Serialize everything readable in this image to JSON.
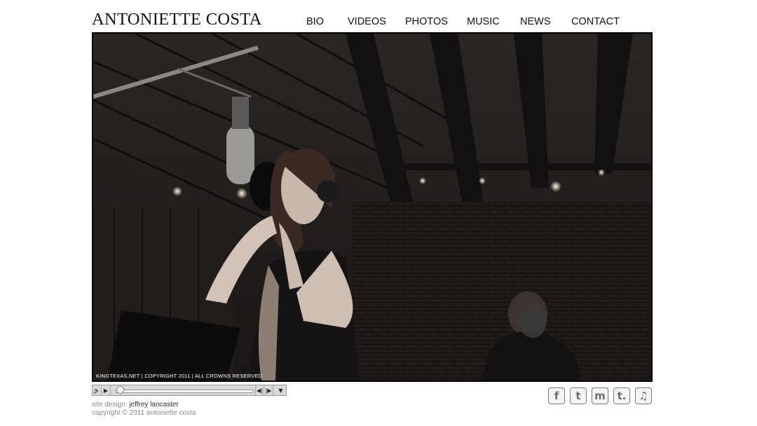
{
  "site": {
    "title": "ANTONIETTE COSTA"
  },
  "nav": {
    "items": [
      {
        "label": "BIO"
      },
      {
        "label": "VIDEOS"
      },
      {
        "label": "PHOTOS"
      },
      {
        "label": "MUSIC"
      },
      {
        "label": "NEWS"
      },
      {
        "label": "CONTACT"
      }
    ]
  },
  "photo": {
    "credit": "KINGTEXAS.NET | COPYRIGHT 2011 | ALL CROWNS RESERVED",
    "description_icon": "recording-studio-photo"
  },
  "player": {
    "volume_icon": "speaker-icon",
    "play_icon": "play-icon",
    "prev_icon": "previous-track-icon",
    "next_icon": "next-track-icon",
    "menu_icon": "dropdown-arrow-icon",
    "progress": 0.0
  },
  "footer": {
    "design_label": "site design:",
    "designer": "jeffrey lancaster",
    "copyright": "copyright © 2011 antoniette costa"
  },
  "social": {
    "items": [
      {
        "glyph": "f",
        "icon": "facebook-icon"
      },
      {
        "glyph": "t",
        "icon": "twitter-icon"
      },
      {
        "glyph": "m",
        "icon": "myspace-icon"
      },
      {
        "glyph": "t.",
        "icon": "tumblr-icon"
      },
      {
        "glyph": "♫",
        "icon": "music-icon"
      }
    ]
  },
  "colors": {
    "background": "#ffffff",
    "text": "#111111",
    "footer_text": "#8a8a8a",
    "frame": "#000000"
  }
}
